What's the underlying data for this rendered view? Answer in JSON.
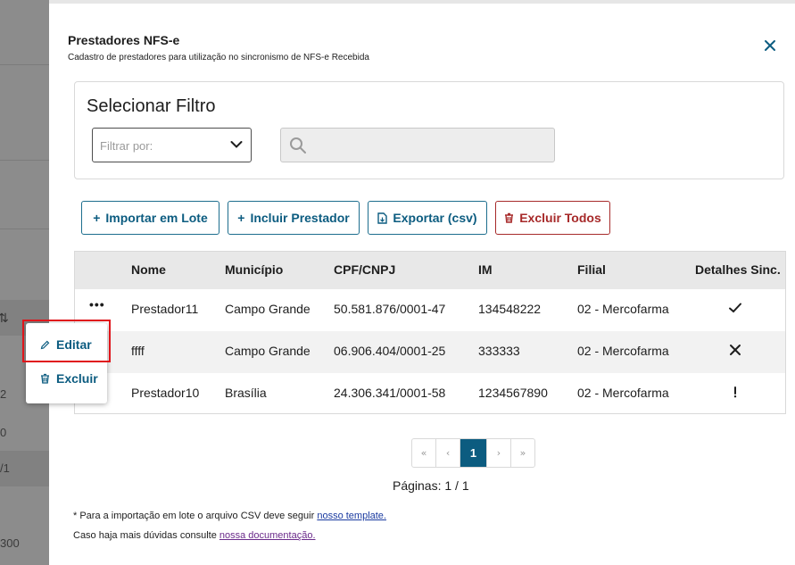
{
  "backdrop": {
    "sort_glyph": "⇅",
    "cells": [
      "2",
      "0",
      "/1",
      "300"
    ]
  },
  "header": {
    "title": "Prestadores NFS-e",
    "subtitle": "Cadastro de prestadores para utilização no sincronismo de NFS-e Recebida",
    "close_icon": "close-icon"
  },
  "filter": {
    "title": "Selecionar Filtro",
    "select_placeholder": "Filtrar por:",
    "search_value": ""
  },
  "actions": {
    "import_label": "Importar em Lote",
    "include_label": "Incluir Prestador",
    "export_label": "Exportar (csv)",
    "delete_all_label": "Excluir Todos"
  },
  "table": {
    "columns": [
      "Nome",
      "Município",
      "CPF/CNPJ",
      "IM",
      "Filial",
      "Detalhes Sinc."
    ],
    "rows": [
      {
        "nome": "Prestador11",
        "municipio": "Campo Grande",
        "cnpj": "50.581.876/0001-47",
        "im": "134548222",
        "filial": "02 - Mercofarma",
        "sync": "check"
      },
      {
        "nome": "ffff",
        "municipio": "Campo Grande",
        "cnpj": "06.906.404/0001-25",
        "im": "333333",
        "filial": "02 - Mercofarma",
        "sync": "error"
      },
      {
        "nome": "Prestador10",
        "municipio": "Brasília",
        "cnpj": "24.306.341/0001-58",
        "im": "1234567890",
        "filial": "02 - Mercofarma",
        "sync": "warning"
      }
    ],
    "row_actions_glyph": "•••"
  },
  "context_menu": {
    "edit_label": "Editar",
    "delete_label": "Excluir"
  },
  "pagination": {
    "first": "«",
    "prev": "‹",
    "current": "1",
    "next": "›",
    "last": "»",
    "summary": "Páginas: 1 / 1"
  },
  "footer": {
    "note1_text": "* Para a importação em lote o arquivo CSV deve seguir",
    "note1_link": "nosso template.",
    "note2_text": "Caso haja mais dúvidas consulte",
    "note2_link": "nossa documentação."
  },
  "colors": {
    "primary": "#0c5c80",
    "danger": "#a72a2a",
    "highlight": "#e0151b"
  }
}
